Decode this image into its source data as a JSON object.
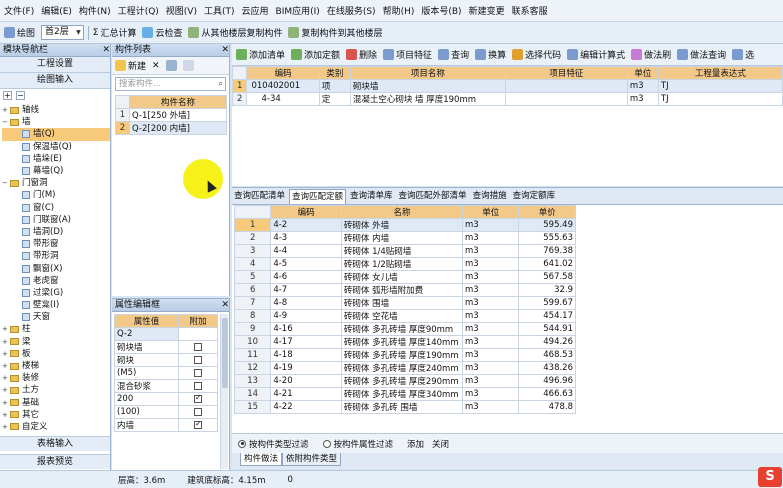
{
  "menu": [
    "文件(F)",
    "编辑(E)",
    "构件(N)",
    "工程计(Q)",
    "视图(V)",
    "工具(T)",
    "云应用",
    "BIM应用(I)",
    "在线服务(S)",
    "帮助(H)",
    "版本号(B)",
    "新建变更",
    "联系客服"
  ],
  "toolbar": {
    "draw_label": "绘图",
    "floor_value": "首2层",
    "sum_calc": "汇总计算",
    "cloud_check": "云检查",
    "copy_from_floor": "从其他楼层复制构件",
    "copy_to_floor": "复制构件到其他楼层"
  },
  "nav": {
    "title": "模块导航栏",
    "btn_settings": "工程设置",
    "btn_draw": "绘图输入",
    "plus": "+",
    "minus": "−",
    "tree": [
      {
        "label": "轴线",
        "level": 0,
        "kind": "folder",
        "exp": "+"
      },
      {
        "label": "墙",
        "level": 0,
        "kind": "folder",
        "exp": "−"
      },
      {
        "label": "墙(Q)",
        "level": 1,
        "kind": "leaf",
        "sel": true
      },
      {
        "label": "保温墙(Q)",
        "level": 1,
        "kind": "leaf"
      },
      {
        "label": "墙垛(E)",
        "level": 1,
        "kind": "leaf"
      },
      {
        "label": "幕墙(Q)",
        "level": 1,
        "kind": "leaf"
      },
      {
        "label": "门窗洞",
        "level": 0,
        "kind": "folder",
        "exp": "−"
      },
      {
        "label": "门(M)",
        "level": 1,
        "kind": "leaf"
      },
      {
        "label": "窗(C)",
        "level": 1,
        "kind": "leaf"
      },
      {
        "label": "门联窗(A)",
        "level": 1,
        "kind": "leaf"
      },
      {
        "label": "墙洞(D)",
        "level": 1,
        "kind": "leaf"
      },
      {
        "label": "带形窗",
        "level": 1,
        "kind": "leaf"
      },
      {
        "label": "带形洞",
        "level": 1,
        "kind": "leaf"
      },
      {
        "label": "飘窗(X)",
        "level": 1,
        "kind": "leaf"
      },
      {
        "label": "老虎窗",
        "level": 1,
        "kind": "leaf"
      },
      {
        "label": "过梁(G)",
        "level": 1,
        "kind": "leaf"
      },
      {
        "label": "壁龛(I)",
        "level": 1,
        "kind": "leaf"
      },
      {
        "label": "天窗",
        "level": 1,
        "kind": "leaf"
      },
      {
        "label": "柱",
        "level": 0,
        "kind": "folder",
        "exp": "+"
      },
      {
        "label": "梁",
        "level": 0,
        "kind": "folder",
        "exp": "+"
      },
      {
        "label": "板",
        "level": 0,
        "kind": "folder",
        "exp": "+"
      },
      {
        "label": "楼梯",
        "level": 0,
        "kind": "folder",
        "exp": "+"
      },
      {
        "label": "装修",
        "level": 0,
        "kind": "folder",
        "exp": "+"
      },
      {
        "label": "土方",
        "level": 0,
        "kind": "folder",
        "exp": "+"
      },
      {
        "label": "基础",
        "level": 0,
        "kind": "folder",
        "exp": "+"
      },
      {
        "label": "其它",
        "level": 0,
        "kind": "folder",
        "exp": "+"
      },
      {
        "label": "自定义",
        "level": 0,
        "kind": "folder",
        "exp": "+"
      }
    ],
    "btn_table": "表格输入",
    "btn_report": "报表预览"
  },
  "complist": {
    "title": "构件列表",
    "new_label": "新建",
    "search_placeholder": "搜索构件...",
    "header": "构件名称",
    "items": [
      {
        "n": "1",
        "name": "Q-1[250 外墙]"
      },
      {
        "n": "2",
        "name": "Q-2[200 内墙]",
        "sel": true
      }
    ]
  },
  "props": {
    "title": "属性编辑框",
    "h_value": "属性值",
    "h_add": "附加",
    "rows": [
      {
        "v": "Q-2",
        "c": null
      },
      {
        "v": "砌块墙",
        "c": false
      },
      {
        "v": "砌块",
        "c": false
      },
      {
        "v": "(M5)",
        "c": false
      },
      {
        "v": "混合砂浆",
        "c": false
      },
      {
        "v": "200",
        "c": true
      },
      {
        "v": "(100)",
        "c": false
      },
      {
        "v": "内墙",
        "c": true
      }
    ]
  },
  "maintb": [
    "添加清单",
    "添加定额",
    "删除",
    "项目特征",
    "查询",
    "换算",
    "选择代码",
    "编辑计算式",
    "做法刷",
    "做法查询",
    "选"
  ],
  "upper": {
    "headers": [
      "编码",
      "类别",
      "项目名称",
      "项目特征",
      "单位",
      "工程量表达式"
    ],
    "rows": [
      {
        "n": "1",
        "code": "010402001",
        "cat": "项",
        "name": "砌块墙",
        "feat": "",
        "unit": "m3",
        "expr": "TJ",
        "sel": true
      },
      {
        "n": "2",
        "code": "4-34",
        "cat": "定",
        "name": "混凝土空心砌块 墙 厚度190mm",
        "feat": "",
        "unit": "m3",
        "expr": "TJ"
      }
    ]
  },
  "tabs": [
    "查询匹配清单",
    "查询匹配定额",
    "查询清单库",
    "查询匹配外部清单",
    "查询措施",
    "查询定额库"
  ],
  "lower": {
    "headers": [
      "编码",
      "名称",
      "单位",
      "单价"
    ],
    "rows": [
      {
        "n": "1",
        "code": "4-2",
        "name": "砖砌体 外墙",
        "unit": "m3",
        "price": "595.49"
      },
      {
        "n": "2",
        "code": "4-3",
        "name": "砖砌体 内墙",
        "unit": "m3",
        "price": "555.63"
      },
      {
        "n": "3",
        "code": "4-4",
        "name": "砖砌体 1/4贴砌墙",
        "unit": "m3",
        "price": "769.38"
      },
      {
        "n": "4",
        "code": "4-5",
        "name": "砖砌体 1/2贴砌墙",
        "unit": "m3",
        "price": "641.02"
      },
      {
        "n": "5",
        "code": "4-6",
        "name": "砖砌体 女儿墙",
        "unit": "m3",
        "price": "567.58"
      },
      {
        "n": "6",
        "code": "4-7",
        "name": "砖砌体 弧形墙附加费",
        "unit": "m3",
        "price": "32.9"
      },
      {
        "n": "7",
        "code": "4-8",
        "name": "砖砌体 围墙",
        "unit": "m3",
        "price": "599.67"
      },
      {
        "n": "8",
        "code": "4-9",
        "name": "砖砌体 空花墙",
        "unit": "m3",
        "price": "454.17"
      },
      {
        "n": "9",
        "code": "4-16",
        "name": "砖砌体 多孔砖墙 厚度90mm",
        "unit": "m3",
        "price": "544.91"
      },
      {
        "n": "10",
        "code": "4-17",
        "name": "砖砌体 多孔砖墙 厚度140mm",
        "unit": "m3",
        "price": "494.26"
      },
      {
        "n": "11",
        "code": "4-18",
        "name": "砖砌体 多孔砖墙 厚度190mm",
        "unit": "m3",
        "price": "468.53"
      },
      {
        "n": "12",
        "code": "4-19",
        "name": "砖砌体 多孔砖墙 厚度240mm",
        "unit": "m3",
        "price": "438.26"
      },
      {
        "n": "13",
        "code": "4-20",
        "name": "砖砌体 多孔砖墙 厚度290mm",
        "unit": "m3",
        "price": "496.96"
      },
      {
        "n": "14",
        "code": "4-21",
        "name": "砖砌体 多孔砖墙 厚度340mm",
        "unit": "m3",
        "price": "466.63"
      },
      {
        "n": "15",
        "code": "4-22",
        "name": "砖砌体 多孔砖 围墙",
        "unit": "m3",
        "price": "478.8"
      }
    ]
  },
  "lowerbar": {
    "r1": "按构件类型过滤",
    "r2": "按构件属性过滤",
    "add": "添加",
    "close": "关闭"
  },
  "btabs": [
    "构件做法",
    "依附构件类型"
  ],
  "status": {
    "floor_h": "层高：3.6m",
    "base_h": "建筑底标高：4.15m",
    "zero": "0"
  },
  "logo": "S",
  "colors": {
    "accent": "#f3c98a",
    "select": "#f6c97b",
    "panel": "#d7e4f2"
  }
}
